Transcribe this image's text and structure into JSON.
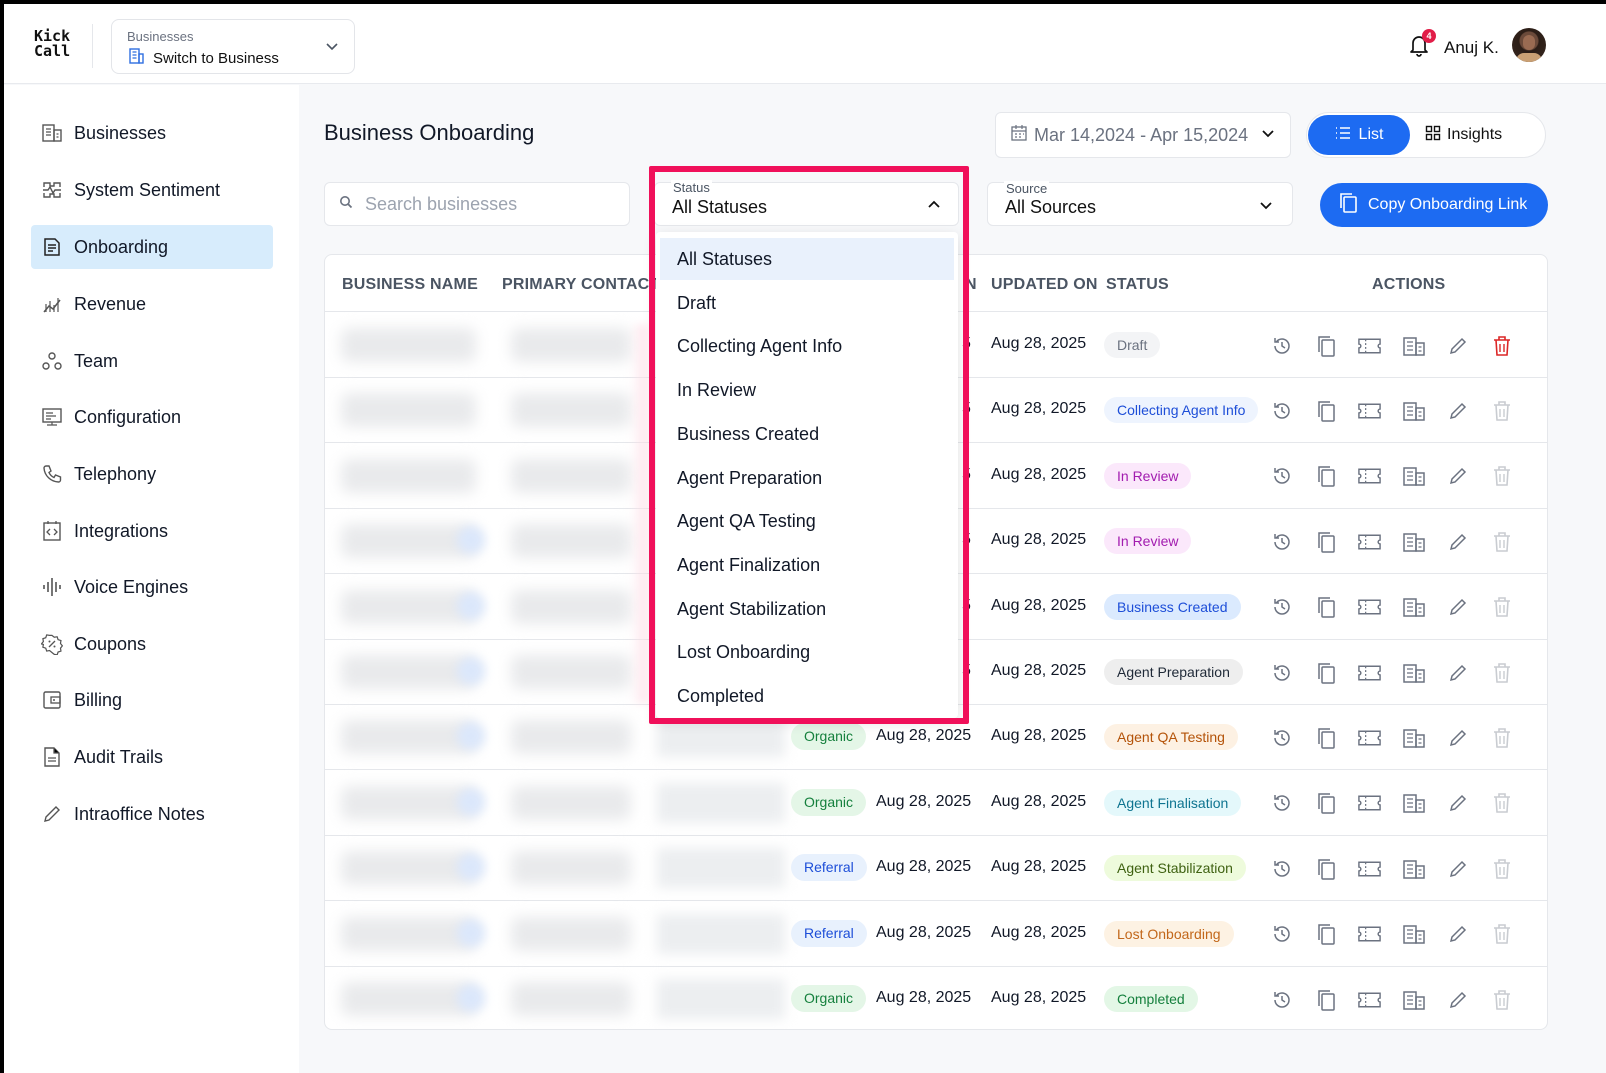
{
  "app": {
    "logo_line1": "Kick",
    "logo_line2": "Call",
    "business_switcher": {
      "small_label": "Businesses",
      "label": "Switch to Business"
    },
    "notifications_count": "4",
    "user_name": "Anuj K."
  },
  "sidebar": {
    "items": [
      {
        "label": "Businesses",
        "icon": "building-icon"
      },
      {
        "label": "System Sentiment",
        "icon": "heart-pulse-icon"
      },
      {
        "label": "Onboarding",
        "icon": "document-icon",
        "active": true
      },
      {
        "label": "Revenue",
        "icon": "chart-icon"
      },
      {
        "label": "Team",
        "icon": "team-icon"
      },
      {
        "label": "Configuration",
        "icon": "config-icon"
      },
      {
        "label": "Telephony",
        "icon": "phone-icon"
      },
      {
        "label": "Integrations",
        "icon": "code-icon"
      },
      {
        "label": "Voice Engines",
        "icon": "waveform-icon"
      },
      {
        "label": "Coupons",
        "icon": "coupon-icon"
      },
      {
        "label": "Billing",
        "icon": "wallet-icon"
      },
      {
        "label": "Audit Trails",
        "icon": "file-icon"
      },
      {
        "label": "Intraoffice Notes",
        "icon": "pencil-icon"
      }
    ]
  },
  "main": {
    "title": "Business Onboarding",
    "date_range": "Mar 14,2024 - Apr 15,2024",
    "view_toggle": {
      "list": "List",
      "insights": "Insights"
    },
    "search_placeholder": "Search businesses",
    "status_filter": {
      "label": "Status",
      "value": "All Statuses",
      "options": [
        "All Statuses",
        "Draft",
        "Collecting Agent Info",
        "In Review",
        "Business Created",
        "Agent Preparation",
        "Agent QA Testing",
        "Agent Finalization",
        "Agent Stabilization",
        "Lost Onboarding",
        "Completed"
      ]
    },
    "source_filter": {
      "label": "Source",
      "value": "All Sources"
    },
    "copy_button": "Copy Onboarding Link"
  },
  "table": {
    "headers": {
      "business_name": "BUSINESS NAME",
      "primary_contact": "PRIMARY CONTACT",
      "created_on_partial": "N",
      "updated_on": "UPDATED ON",
      "status": "STATUS",
      "actions": "ACTIONS"
    },
    "rows": [
      {
        "source": "",
        "created": "",
        "created_partial": "5",
        "updated": "Aug 28, 2025",
        "status": "Draft",
        "status_color": "#f3f4f6",
        "status_text_color": "#6b7280"
      },
      {
        "source": "",
        "created": "",
        "created_partial": "5",
        "updated": "Aug 28, 2025",
        "status": "Collecting Agent Info",
        "status_color": "#eef4fe",
        "status_text_color": "#1d4ed8"
      },
      {
        "source": "",
        "created": "",
        "created_partial": "5",
        "updated": "Aug 28, 2025",
        "status": "In Review",
        "status_color": "#fbe8fb",
        "status_text_color": "#a21caf"
      },
      {
        "source": "",
        "created": "",
        "created_partial": "5",
        "updated": "Aug 28, 2025",
        "status": "In Review",
        "status_color": "#fbe8fb",
        "status_text_color": "#a21caf"
      },
      {
        "source": "",
        "created": "",
        "created_partial": "5",
        "updated": "Aug 28, 2025",
        "status": "Business Created",
        "status_color": "#dbeafe",
        "status_text_color": "#1d4ed8"
      },
      {
        "source": "",
        "created": "",
        "created_partial": "5",
        "updated": "Aug 28, 2025",
        "status": "Agent Preparation",
        "status_color": "#eeeeee",
        "status_text_color": "#1f2937"
      },
      {
        "source": "Organic",
        "created": "Aug 28, 2025",
        "created_partial": "",
        "updated": "Aug 28, 2025",
        "status": "Agent QA Testing",
        "status_color": "#fdf1e3",
        "status_text_color": "#b45309"
      },
      {
        "source": "Organic",
        "created": "Aug 28, 2025",
        "created_partial": "",
        "updated": "Aug 28, 2025",
        "status": "Agent Finalisation",
        "status_color": "#e4f8fb",
        "status_text_color": "#0e7490"
      },
      {
        "source": "Referral",
        "created": "Aug 28, 2025",
        "created_partial": "",
        "updated": "Aug 28, 2025",
        "status": "Agent Stabilization",
        "status_color": "#eefbdc",
        "status_text_color": "#3f6212"
      },
      {
        "source": "Referral",
        "created": "Aug 28, 2025",
        "created_partial": "",
        "updated": "Aug 28, 2025",
        "status": "Lost Onboarding",
        "status_color": "#fdf2e3",
        "status_text_color": "#c2671a"
      },
      {
        "source": "Organic",
        "created": "Aug 28, 2025",
        "created_partial": "",
        "updated": "Aug 28, 2025",
        "status": "Completed",
        "status_color": "#e3f7e6",
        "status_text_color": "#15803d"
      }
    ],
    "source_colors": {
      "Organic": {
        "bg": "#e4f6e7",
        "fg": "#15803d"
      },
      "Referral": {
        "bg": "#e8f1fd",
        "fg": "#1d4ed8"
      }
    }
  },
  "colors": {
    "accent": "#1d6bf2",
    "highlight": "#f0105a",
    "delete": "#dc2626"
  }
}
